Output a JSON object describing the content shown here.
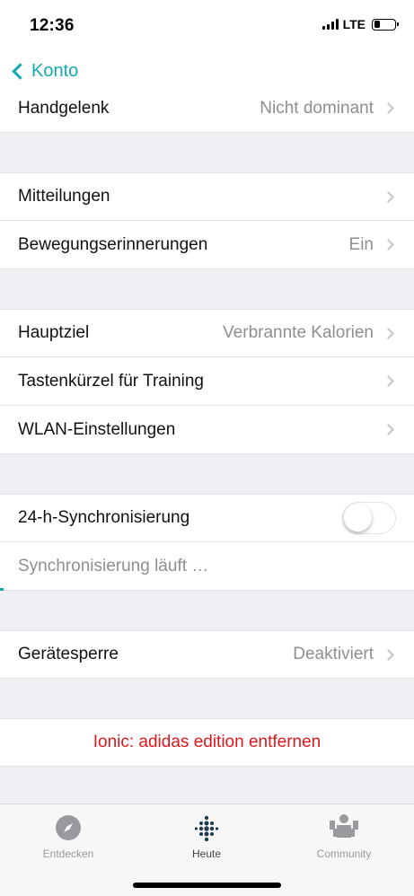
{
  "status": {
    "time": "12:36",
    "network": "LTE"
  },
  "nav": {
    "back_label": "Konto"
  },
  "rows": {
    "wrist": {
      "label": "Handgelenk",
      "value": "Nicht dominant"
    },
    "notifications": {
      "label": "Mitteilungen"
    },
    "movement_reminders": {
      "label": "Bewegungserinnerungen",
      "value": "Ein"
    },
    "main_goal": {
      "label": "Hauptziel",
      "value": "Verbrannte Kalorien"
    },
    "training_shortcuts": {
      "label": "Tastenkürzel für Training"
    },
    "wifi_settings": {
      "label": "WLAN-Einstellungen"
    },
    "sync_24h": {
      "label": "24-h-Synchronisierung",
      "enabled": false
    },
    "sync_status": {
      "label": "Synchronisierung läuft …"
    },
    "device_lock": {
      "label": "Gerätesperre",
      "value": "Deaktiviert"
    },
    "remove_device": {
      "label": "Ionic: adidas edition entfernen"
    }
  },
  "tabs": [
    {
      "label": "Entdecken",
      "icon": "compass-icon",
      "active": false
    },
    {
      "label": "Heute",
      "icon": "fitbit-dots-icon",
      "active": true
    },
    {
      "label": "Community",
      "icon": "community-icon",
      "active": false
    }
  ],
  "colors": {
    "accent": "#12aab3",
    "danger": "#e0161b",
    "secondary_text": "#8e8e93",
    "background": "#efeff4"
  }
}
